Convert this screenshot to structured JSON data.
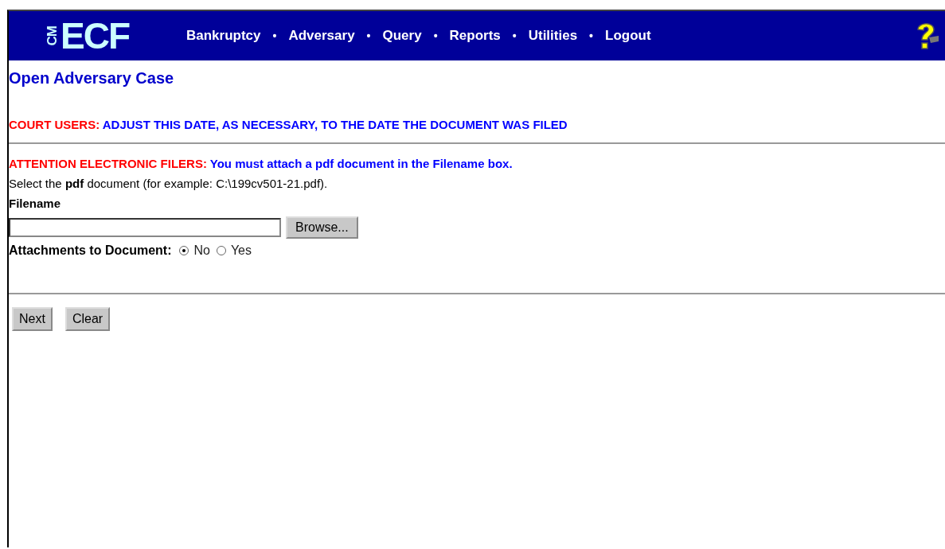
{
  "header": {
    "logo": {
      "small": "CM",
      "large": "ECF"
    },
    "menu": [
      {
        "label": "Bankruptcy"
      },
      {
        "label": "Adversary"
      },
      {
        "label": "Query"
      },
      {
        "label": "Reports"
      },
      {
        "label": "Utilities"
      },
      {
        "label": "Logout"
      }
    ],
    "separator": "•"
  },
  "page_title": "Open Adversary Case",
  "notices": [
    {
      "label": "COURT USERS:",
      "message": "ADJUST THIS DATE, AS NECESSARY, TO THE DATE THE DOCUMENT WAS FILED"
    },
    {
      "label": "ATTENTION ELECTRONIC FILERS:",
      "message": "You must attach a pdf document in the Filename box."
    }
  ],
  "instruction": "Select the **pdf** document (for example: C:\\199cv501-21.pdf).",
  "filename": {
    "label": "Filename",
    "browse_button": "Browse..."
  },
  "attachments": {
    "label": "Attachments to Document:",
    "options": [
      {
        "label": "No",
        "selected": true
      },
      {
        "label": "Yes",
        "selected": false
      }
    ]
  },
  "buttons": [
    "Next",
    "Clear"
  ]
}
